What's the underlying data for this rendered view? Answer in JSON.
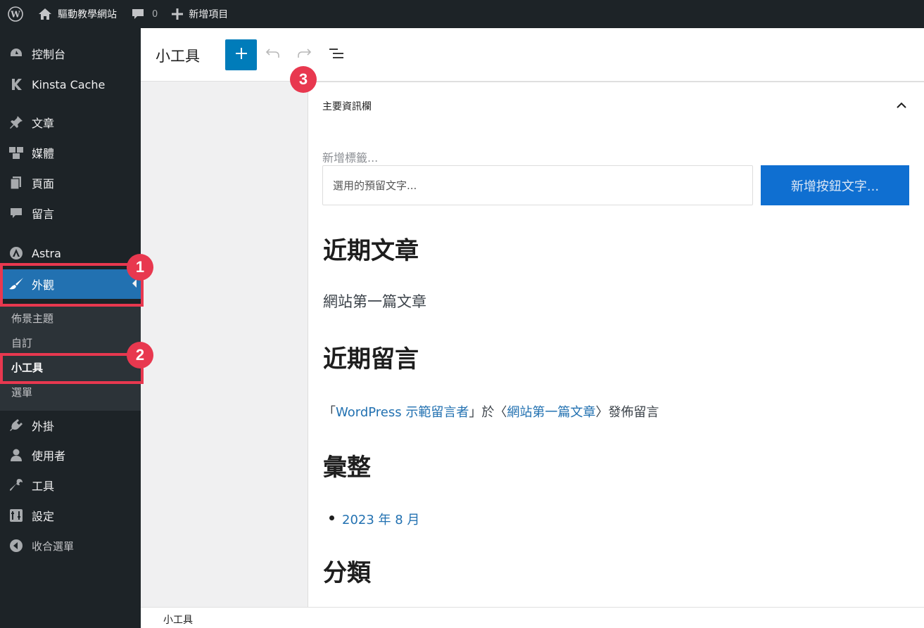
{
  "adminbar": {
    "site_name": "驅動教學網站",
    "comment_count": "0",
    "new_label": "新增項目"
  },
  "sidebar": {
    "items": [
      {
        "label": "控制台",
        "icon": "dashboard-icon"
      },
      {
        "label": "Kinsta Cache",
        "icon": "kinsta-icon"
      },
      {
        "label": "文章",
        "icon": "pin-icon"
      },
      {
        "label": "媒體",
        "icon": "media-icon"
      },
      {
        "label": "頁面",
        "icon": "page-icon"
      },
      {
        "label": "留言",
        "icon": "comment-icon"
      },
      {
        "label": "Astra",
        "icon": "astra-icon"
      },
      {
        "label": "外觀",
        "icon": "brush-icon"
      },
      {
        "label": "外掛",
        "icon": "plugin-icon"
      },
      {
        "label": "使用者",
        "icon": "user-icon"
      },
      {
        "label": "工具",
        "icon": "wrench-icon"
      },
      {
        "label": "設定",
        "icon": "settings-icon"
      },
      {
        "label": "收合選單",
        "icon": "collapse-icon"
      }
    ],
    "submenu": [
      "佈景主題",
      "自訂",
      "小工具",
      "選單"
    ]
  },
  "header": {
    "title": "小工具"
  },
  "widget_area": {
    "title": "主要資訊欄",
    "search_label": "新增標籤...",
    "search_placeholder": "選用的預留文字...",
    "search_button": "新增按鈕文字...",
    "recent_posts_heading": "近期文章",
    "recent_post_link": "網站第一篇文章",
    "recent_comments_heading": "近期留言",
    "comment_open": "「",
    "comment_author": "WordPress 示範留言者",
    "comment_mid": "」於〈",
    "comment_post": "網站第一篇文章",
    "comment_end": "〉發佈留言",
    "archives_heading": "彙整",
    "archive_item": "2023 年 8 月",
    "categories_heading": "分類"
  },
  "footer": {
    "breadcrumb": "小工具"
  },
  "annotations": [
    "1",
    "2",
    "3"
  ],
  "colors": {
    "annotation": "#e8384f",
    "accent": "#2271b1",
    "primary_button": "#007cba"
  }
}
